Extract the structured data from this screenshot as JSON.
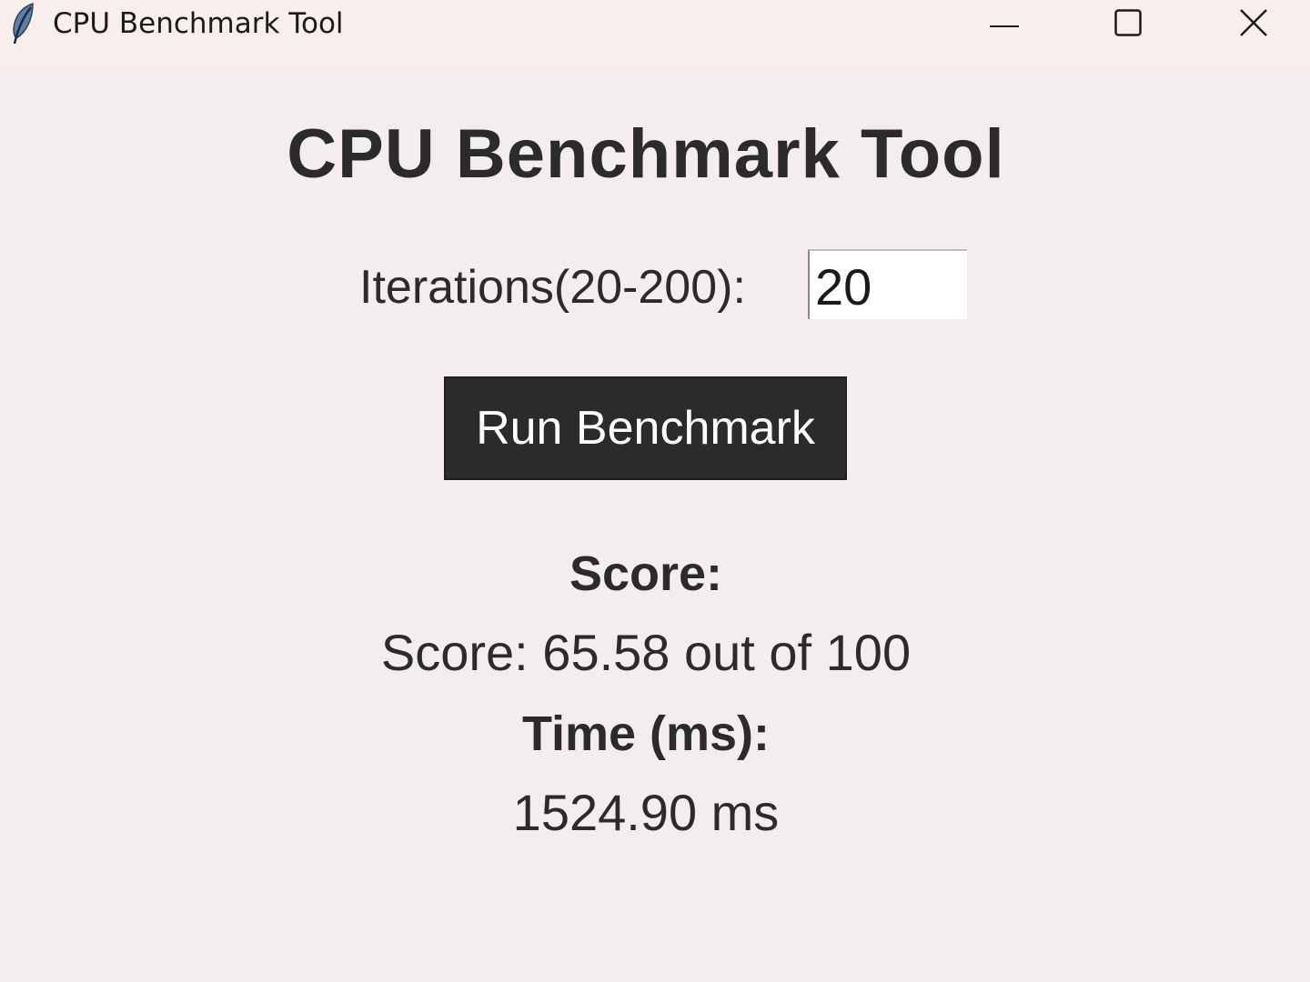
{
  "window": {
    "title": "CPU Benchmark Tool",
    "icon": "feather-icon",
    "controls": [
      "minimize-icon",
      "maximize-icon",
      "close-icon"
    ]
  },
  "main": {
    "title": "CPU Benchmark Tool",
    "iterations_label": "Iterations(20-200):",
    "iterations_value": "20",
    "run_button_label": "Run Benchmark",
    "score_heading": "Score:",
    "score_value": "Score: 65.58 out of 100",
    "time_heading": "Time (ms):",
    "time_value": "1524.90 ms"
  },
  "colors": {
    "background": "#f3eded",
    "titlebar": "#f8efec",
    "button_bg": "#2b2b2b",
    "button_text": "#ffffff",
    "text": "#2b2b2b"
  }
}
